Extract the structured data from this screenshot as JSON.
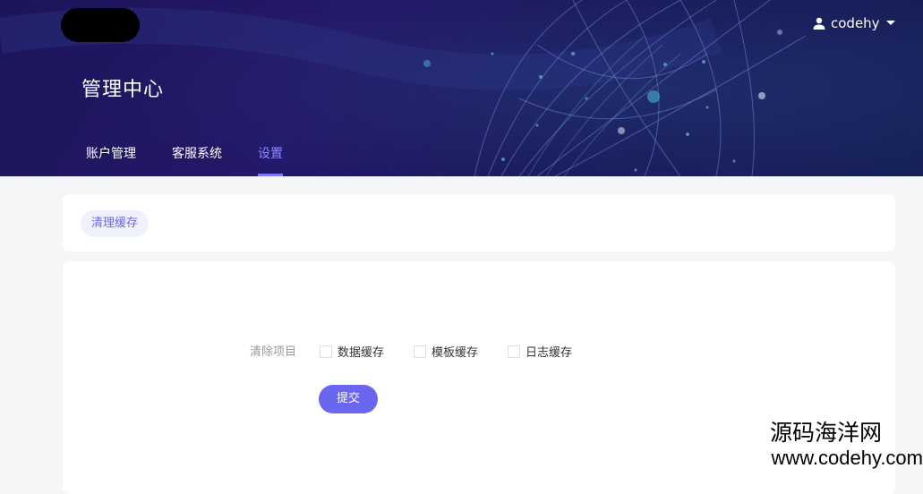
{
  "header": {
    "title": "管理中心",
    "username": "codehy",
    "user_icon": "user-icon",
    "dropdown_icon": "caret-down-icon",
    "nav": [
      {
        "label": "账户管理",
        "active": false
      },
      {
        "label": "客服系统",
        "active": false
      },
      {
        "label": "设置",
        "active": true
      }
    ]
  },
  "tabs": {
    "clear_cache": "清理缓存"
  },
  "form": {
    "label": "清除项目",
    "options": [
      {
        "label": "数据缓存",
        "checked": false
      },
      {
        "label": "模板缓存",
        "checked": false
      },
      {
        "label": "日志缓存",
        "checked": false
      }
    ],
    "submit": "提交"
  },
  "watermark": {
    "line1": "源码海洋网",
    "line2": "www.codehy.com"
  },
  "colors": {
    "accent": "#6b66ef",
    "header_bg": "#1c1559"
  }
}
